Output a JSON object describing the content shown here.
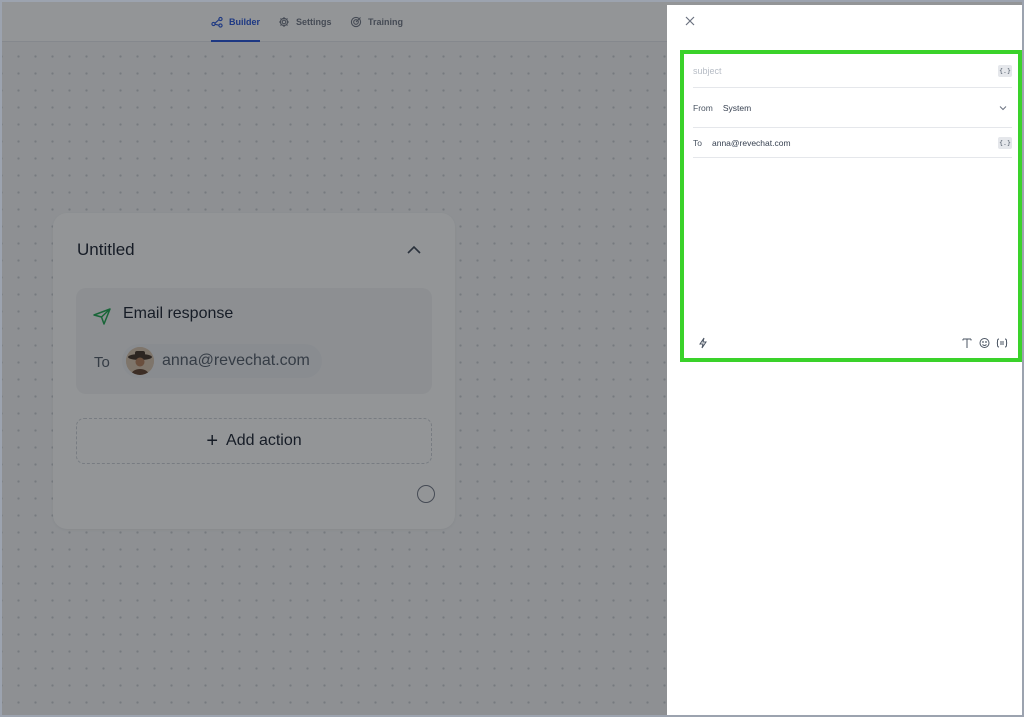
{
  "topbar": {
    "tabs": [
      {
        "label": "Builder",
        "icon": "flow-icon",
        "active": true
      },
      {
        "label": "Settings",
        "icon": "gear-icon",
        "active": false
      },
      {
        "label": "Training",
        "icon": "target-icon",
        "active": false
      }
    ]
  },
  "card": {
    "title": "Untitled",
    "action": {
      "title": "Email response",
      "icon": "send-icon",
      "to_label": "To",
      "recipient": "anna@revechat.com"
    },
    "add_action_label": "Add action",
    "add_action_icon": "+"
  },
  "panel": {
    "close_icon": "×",
    "subject": {
      "value": "",
      "placeholder": "subject",
      "var_icon": "{.}"
    },
    "from": {
      "label": "From",
      "value": "System"
    },
    "to": {
      "label": "To",
      "value": "anna@revechat.com",
      "var_icon": "{.}"
    },
    "toolbar": [
      "lightning-icon",
      "text-format-icon",
      "emoji-icon",
      "variables-icon"
    ]
  },
  "colors": {
    "accent": "#1d4ed8",
    "highlight_border": "#3ad22a",
    "overlay": "#1e2126"
  }
}
